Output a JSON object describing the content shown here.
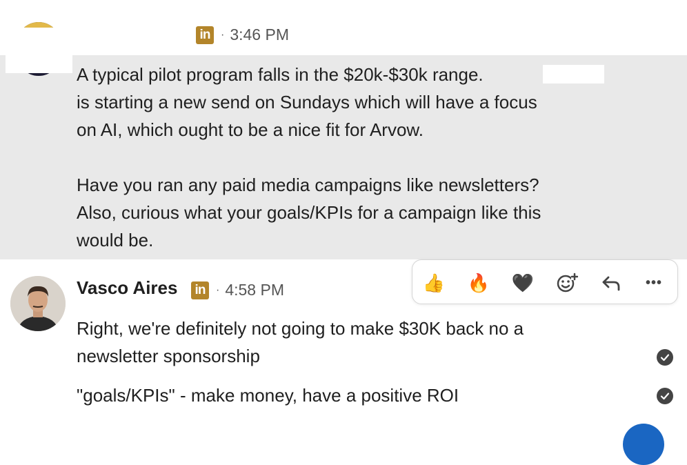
{
  "message1": {
    "time": "3:46 PM",
    "lines": [
      "A typical pilot program falls in the $20k-$30k range.",
      "is starting a new send on Sundays which will have a focus",
      "on AI, which ought to be a nice fit for Arvow.",
      "Have you ran any paid media campaigns like newsletters?",
      "Also, curious what your goals/KPIs for a campaign like this",
      "would be."
    ]
  },
  "message2": {
    "sender": "Vasco Aires",
    "time": "4:58 PM",
    "line1": "Right, we're definitely not going to make $30K back no a",
    "line2": "newsletter sponsorship",
    "line3": "\"goals/KPIs\" - make money, have a positive ROI"
  },
  "linkedin_badge": "in",
  "dot": "·",
  "reactions": {
    "thumbs": "👍",
    "fire": "🔥",
    "heart": "🖤",
    "add": "add-reaction-icon",
    "reply": "reply-icon",
    "more": "•••"
  },
  "colors": {
    "highlight_bg": "#e9e9e9",
    "linkedin_gold": "#b3852a",
    "fab_blue": "#1a66c2"
  }
}
